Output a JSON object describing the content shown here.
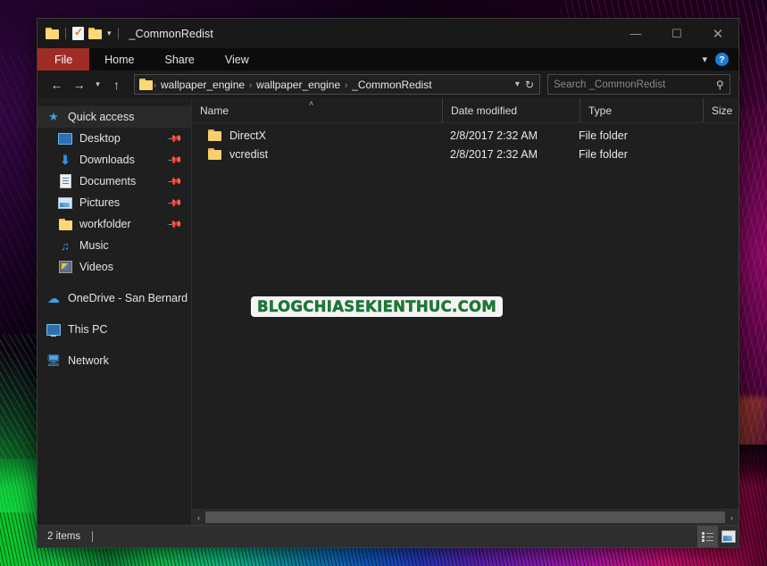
{
  "window": {
    "title": "_CommonRedist",
    "quick_access_toolbar": [
      {
        "icon": "folder-icon"
      },
      {
        "icon": "properties-icon"
      },
      {
        "icon": "folder-icon"
      },
      {
        "icon": "chevron-down-icon"
      }
    ],
    "controls": {
      "minimize": "—",
      "maximize": "☐",
      "close": "✕"
    }
  },
  "ribbon": {
    "tabs": [
      {
        "label": "File",
        "active": true
      },
      {
        "label": "Home",
        "active": false
      },
      {
        "label": "Share",
        "active": false
      },
      {
        "label": "View",
        "active": false
      }
    ],
    "expand_icon": "chevron-down-icon",
    "help_label": "?"
  },
  "nav": {
    "back_icon": "←",
    "forward_icon": "→",
    "recent_icon": "⌄",
    "up_icon": "↑",
    "breadcrumbs": [
      "wallpaper_engine",
      "wallpaper_engine",
      "_CommonRedist"
    ],
    "crumb_separator": "›",
    "dropdown_icon": "⌄",
    "refresh_icon": "↻"
  },
  "search": {
    "placeholder": "Search _CommonRedist",
    "icon": "search-icon"
  },
  "sidebar": {
    "items": [
      {
        "label": "Quick access",
        "icon": "star-icon",
        "pinned": false,
        "indent": false,
        "selected": true
      },
      {
        "label": "Desktop",
        "icon": "desktop-icon",
        "pinned": true,
        "indent": true
      },
      {
        "label": "Downloads",
        "icon": "download-icon",
        "pinned": true,
        "indent": true
      },
      {
        "label": "Documents",
        "icon": "document-icon",
        "pinned": true,
        "indent": true
      },
      {
        "label": "Pictures",
        "icon": "picture-icon",
        "pinned": true,
        "indent": true
      },
      {
        "label": "workfolder",
        "icon": "folder-icon",
        "pinned": true,
        "indent": true
      },
      {
        "label": "Music",
        "icon": "music-icon",
        "pinned": false,
        "indent": true
      },
      {
        "label": "Videos",
        "icon": "video-icon",
        "pinned": false,
        "indent": true
      },
      {
        "label": "OneDrive - San Bernard",
        "icon": "cloud-icon",
        "pinned": false,
        "indent": false
      },
      {
        "label": "This PC",
        "icon": "computer-icon",
        "pinned": false,
        "indent": false
      },
      {
        "label": "Network",
        "icon": "network-icon",
        "pinned": false,
        "indent": false
      }
    ]
  },
  "file_list": {
    "columns": [
      {
        "label": "Name",
        "sorted": "asc",
        "sort_icon": "˄"
      },
      {
        "label": "Date modified"
      },
      {
        "label": "Type"
      },
      {
        "label": "Size"
      }
    ],
    "rows": [
      {
        "name": "DirectX",
        "date_modified": "2/8/2017 2:32 AM",
        "type": "File folder",
        "size": "",
        "icon": "folder-icon"
      },
      {
        "name": "vcredist",
        "date_modified": "2/8/2017 2:32 AM",
        "type": "File folder",
        "size": "",
        "icon": "folder-icon"
      }
    ]
  },
  "scrollbar": {
    "left_icon": "‹",
    "right_icon": "›"
  },
  "statusbar": {
    "item_count": "2 items",
    "view_buttons": [
      {
        "name": "details-view",
        "icon": "details-view-icon",
        "active": true
      },
      {
        "name": "large-icons-view",
        "icon": "tiles-view-icon",
        "active": false
      }
    ]
  },
  "watermark": {
    "text": "BLOGCHIASEKIENTHUC.COM"
  },
  "colors": {
    "file_tab": "#a02c28",
    "help_blue": "#1a7fd4",
    "folder_yellow": "#f6cf6e",
    "watermark_green": "#1a7a34",
    "window_bg": "#1f1f1f",
    "titlebar_bg": "#191919"
  }
}
